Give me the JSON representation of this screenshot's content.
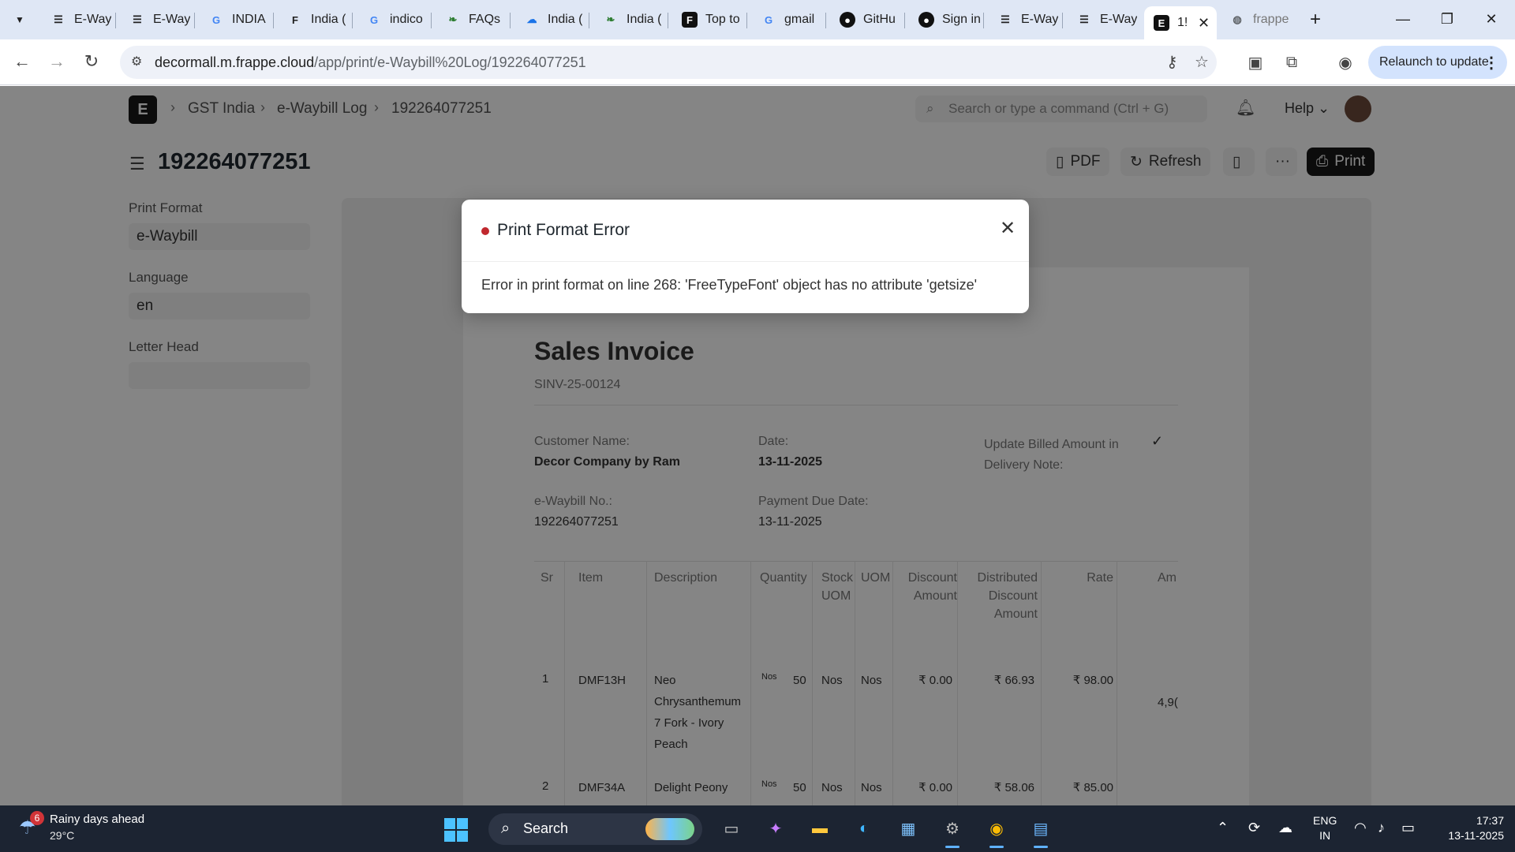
{
  "browser": {
    "tabs": [
      {
        "title": "E-Way",
        "icon": "eway-favicon"
      },
      {
        "title": "E-Way",
        "icon": "eway-favicon"
      },
      {
        "title": "INDIA",
        "icon": "google-favicon"
      },
      {
        "title": "India (",
        "icon": "frappe-favicon"
      },
      {
        "title": "indico",
        "icon": "google-favicon"
      },
      {
        "title": "FAQs",
        "icon": "leaf-favicon"
      },
      {
        "title": "India (",
        "icon": "cloud-favicon"
      },
      {
        "title": "India (",
        "icon": "leaf-favicon"
      },
      {
        "title": "Top to",
        "icon": "frappe-favicon"
      },
      {
        "title": "gmail",
        "icon": "google-favicon"
      },
      {
        "title": "GitHu",
        "icon": "github-favicon"
      },
      {
        "title": "Sign in",
        "icon": "github-favicon"
      },
      {
        "title": "E-Way",
        "icon": "eway-favicon"
      },
      {
        "title": "E-Way",
        "icon": "eway-favicon"
      },
      {
        "title": "1!",
        "icon": "erpnext-favicon"
      },
      {
        "title": "frappe",
        "icon": "globe-favicon"
      }
    ],
    "url_host": "decormall.m.frappe.cloud",
    "url_path": "/app/print/e-Waybill%20Log/192264077251",
    "relaunch_label": "Relaunch to update"
  },
  "app": {
    "breadcrumbs": [
      "GST India",
      "e-Waybill Log",
      "192264077251"
    ],
    "search_placeholder": "Search or type a command (Ctrl + G)",
    "help_label": "Help",
    "page_title": "192264077251",
    "actions": {
      "pdf": "PDF",
      "refresh": "Refresh",
      "more": "···",
      "print": "Print"
    },
    "sidebar": {
      "print_format_label": "Print Format",
      "print_format_value": "e-Waybill",
      "language_label": "Language",
      "language_value": "en",
      "letter_head_label": "Letter Head",
      "letter_head_value": ""
    }
  },
  "invoice": {
    "title": "Sales Invoice",
    "number": "SINV-25-00124",
    "customer_label": "Customer Name:",
    "customer_value": "Decor Company by Ram",
    "date_label": "Date:",
    "date_value": "13-11-2025",
    "update_billed_label": "Update Billed Amount in Delivery Note:",
    "update_billed_value": "✓",
    "ewaybill_label": "e-Waybill No.:",
    "ewaybill_value": "192264077251",
    "due_label": "Payment Due Date:",
    "due_value": "13-11-2025",
    "columns": [
      "Sr",
      "Item",
      "Description",
      "Quantity",
      "Stock UOM",
      "UOM",
      "Discount Amount",
      "Distributed Discount Amount",
      "Rate",
      "Am"
    ],
    "rows": [
      {
        "sr": "1",
        "item": "DMF13H",
        "desc": "Neo Chrysanthemum 7 Fork - Ivory Peach",
        "qty_unit": "Nos",
        "qty": "50",
        "stock_uom": "Nos",
        "uom": "Nos",
        "discount": "₹ 0.00",
        "dist_discount": "₹ 66.93",
        "rate": "₹ 98.00",
        "amount": "4,9("
      },
      {
        "sr": "2",
        "item": "DMF34A",
        "desc": "Delight Peony",
        "qty_unit": "Nos",
        "qty": "50",
        "stock_uom": "Nos",
        "uom": "Nos",
        "discount": "₹ 0.00",
        "dist_discount": "₹ 58.06",
        "rate": "₹ 85.00",
        "amount": ""
      }
    ]
  },
  "modal": {
    "title": "Print Format Error",
    "message": "Error in print format on line 268: 'FreeTypeFont' object has no attribute 'getsize'"
  },
  "taskbar": {
    "weather_badge": "6",
    "weather_line1": "Rainy days ahead",
    "weather_line2": "29°C",
    "search_label": "Search",
    "lang_line1": "ENG",
    "lang_line2": "IN",
    "time": "17:37",
    "date": "13-11-2025"
  },
  "colors": {
    "error_dot": "#c0282e",
    "relaunch_bg": "#d3e3fd",
    "tabstrip_bg": "#dfe7f5",
    "taskbar_bg": "#1c2432"
  }
}
